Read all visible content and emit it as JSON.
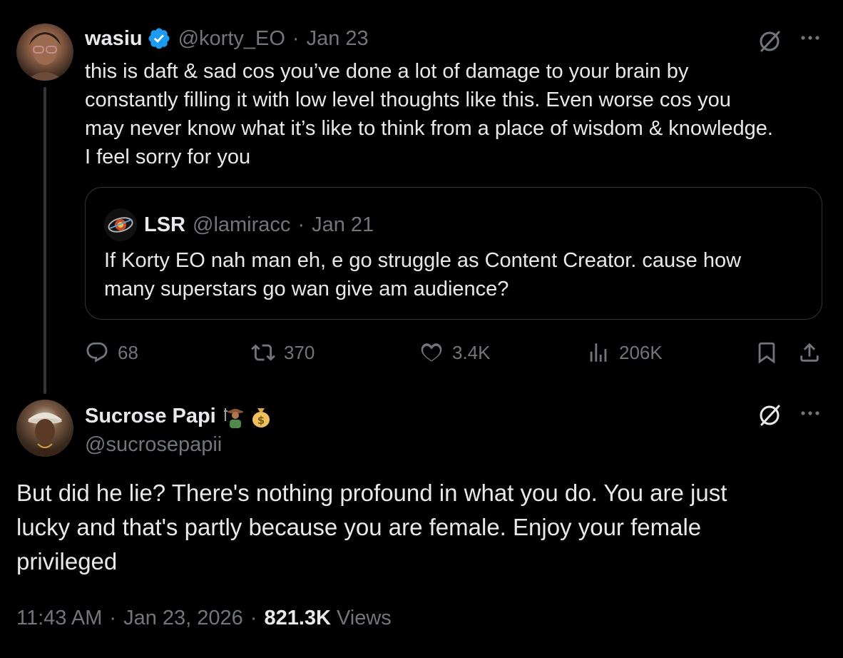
{
  "tweet1": {
    "name": "wasiu",
    "handle": "@korty_EO",
    "separator": "·",
    "date": "Jan 23",
    "body_lines": [
      "this is daft & sad cos you’ve done a lot of damage to your brain by",
      "constantly filling it with low level thoughts like this. Even worse cos you",
      "may never know what it’s like to think from a place of wisdom & knowledge.",
      "I feel sorry for you"
    ],
    "quote": {
      "name": "LSR",
      "handle": "@lamiracc",
      "separator": "·",
      "date": "Jan 21",
      "body_lines": [
        "If Korty EO nah man eh, e go struggle as Content Creator. cause how",
        "many superstars go wan give am audience?"
      ]
    },
    "actions": {
      "replies": "68",
      "reposts": "370",
      "likes": "3.4K",
      "views": "206K"
    }
  },
  "tweet2": {
    "name": "Sucrose Papi",
    "name_emojis": [
      "farmer-emoji",
      "money-bag-emoji"
    ],
    "handle": "@sucrosepapii",
    "body_lines": [
      "But did he lie? There's nothing profound in what you do. You are just",
      "lucky and that's partly because you are female. Enjoy your female",
      "privileged"
    ],
    "time": "11:43 AM",
    "separator": "·",
    "date": "Jan 23, 2026",
    "views_count": "821.3K",
    "views_label": "Views"
  },
  "colors": {
    "background": "#000000",
    "text": "#e7e9ea",
    "muted": "#71767b",
    "border": "#333639",
    "verified": "#1d9bf0"
  },
  "icons": {
    "more": "more-dots-icon",
    "grok": "grok-icon",
    "verified": "verified-badge-icon"
  }
}
